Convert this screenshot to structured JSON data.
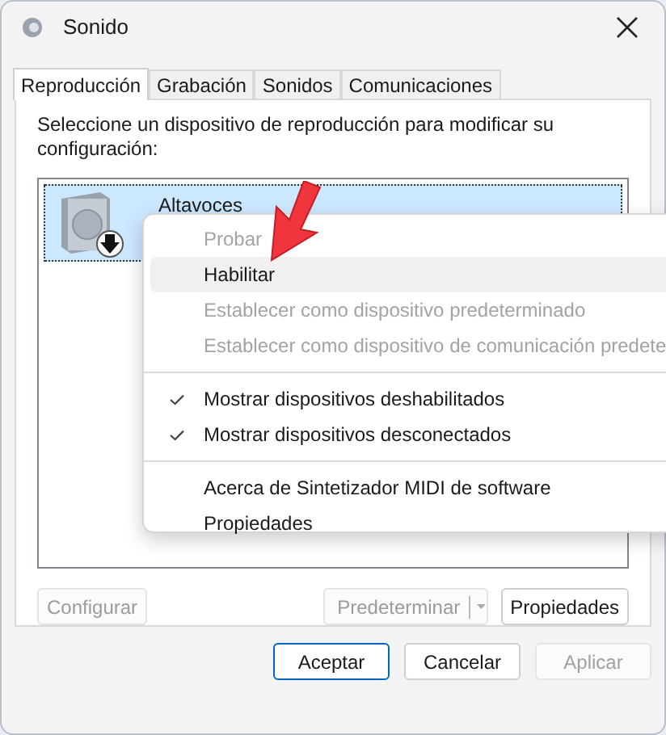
{
  "window": {
    "title": "Sonido"
  },
  "tabs": [
    {
      "label": "Reproducción",
      "selected": true
    },
    {
      "label": "Grabación",
      "selected": false
    },
    {
      "label": "Sonidos",
      "selected": false
    },
    {
      "label": "Comunicaciones",
      "selected": false
    }
  ],
  "instruction": "Seleccione un dispositivo de reproducción para modificar su configuración:",
  "devices": [
    {
      "name": "Altavoces",
      "selected": true,
      "disabled": true
    }
  ],
  "context_menu": [
    {
      "kind": "item",
      "label": "Probar",
      "disabled": true,
      "checked": false,
      "highlighted": false
    },
    {
      "kind": "item",
      "label": "Habilitar",
      "disabled": false,
      "checked": false,
      "highlighted": true
    },
    {
      "kind": "item",
      "label": "Establecer como dispositivo predeterminado",
      "disabled": true,
      "checked": false,
      "highlighted": false
    },
    {
      "kind": "item",
      "label": "Establecer como dispositivo de comunicación predete",
      "disabled": true,
      "checked": false,
      "highlighted": false
    },
    {
      "kind": "separator"
    },
    {
      "kind": "item",
      "label": "Mostrar dispositivos deshabilitados",
      "disabled": false,
      "checked": true,
      "highlighted": false
    },
    {
      "kind": "item",
      "label": "Mostrar dispositivos desconectados",
      "disabled": false,
      "checked": true,
      "highlighted": false
    },
    {
      "kind": "separator"
    },
    {
      "kind": "item",
      "label": "Acerca de Sintetizador MIDI de software",
      "disabled": false,
      "checked": false,
      "highlighted": false
    },
    {
      "kind": "item",
      "label": "Propiedades",
      "disabled": false,
      "checked": false,
      "highlighted": false
    }
  ],
  "panel_buttons": [
    {
      "kind": "plain",
      "label": "Configurar",
      "disabled": true
    },
    {
      "kind": "split",
      "label": "Predeterminar",
      "disabled": true
    },
    {
      "kind": "plain",
      "label": "Propiedades",
      "disabled": false
    }
  ],
  "dialog_buttons": [
    {
      "label": "Aceptar",
      "disabled": false,
      "default": true
    },
    {
      "label": "Cancelar",
      "disabled": false,
      "default": false
    },
    {
      "label": "Aplicar",
      "disabled": true,
      "default": false
    }
  ]
}
